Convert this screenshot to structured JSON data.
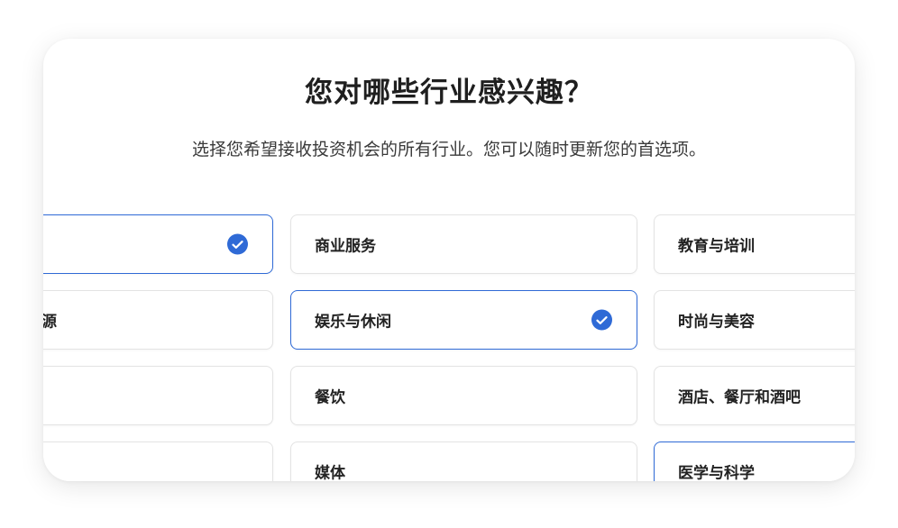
{
  "header": {
    "title": "您对哪些行业感兴趣？",
    "subtitle": "选择您希望接收投资机会的所有行业。您可以随时更新您的首选项。"
  },
  "colors": {
    "accent": "#2f6ad6",
    "card_border": "#e3e3e3",
    "text": "#1f1f1f"
  },
  "industries": {
    "left": [
      {
        "label": "",
        "selected": true
      },
      {
        "label": "资源",
        "selected": false
      },
      {
        "label": "",
        "selected": false
      },
      {
        "label": "",
        "selected": false
      }
    ],
    "middle": [
      {
        "label": "商业服务",
        "selected": false
      },
      {
        "label": "娱乐与休闲",
        "selected": true
      },
      {
        "label": "餐饮",
        "selected": false
      },
      {
        "label": "媒体",
        "selected": false
      }
    ],
    "right": [
      {
        "label": "教育与培训",
        "selected": false
      },
      {
        "label": "时尚与美容",
        "selected": false
      },
      {
        "label": "酒店、餐厅和酒吧",
        "selected": false
      },
      {
        "label": "医学与科学",
        "selected": true
      }
    ]
  }
}
